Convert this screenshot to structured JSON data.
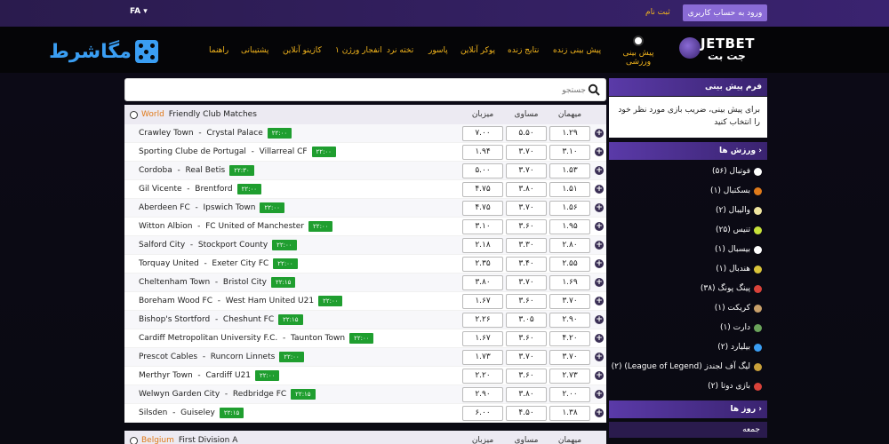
{
  "topbar": {
    "lang": "FA ▾",
    "register": "ثبت نام",
    "login": "ورود به حساب کاربری"
  },
  "logos": {
    "left": "مگاشرط",
    "right_latin": "JETBET",
    "right_fa": "جت بت"
  },
  "nav": {
    "sport_label": "پیش بینی ورزشی",
    "items": [
      "پیش بینی زنده",
      "نتایج زنده",
      "پوکر آنلاین",
      "پاسور",
      "تخته نرد",
      "انفجار ورژن ۱",
      "کازینو آنلاین",
      "پشتیبانی",
      "راهنما"
    ]
  },
  "sidebar": {
    "form_title": "فرم پیش بینی",
    "form_text": "برای پیش بینی، ضریب بازی مورد نظر خود را انتخاب کنید",
    "sports_title": "ورزش ها",
    "sports": [
      {
        "label": "فوتبال (۵۶)",
        "color": "#ffffff"
      },
      {
        "label": "بسکتبال (۱)",
        "color": "#e07a1a"
      },
      {
        "label": "والیبال (۲)",
        "color": "#f0e6a0"
      },
      {
        "label": "تنیس (۲۵)",
        "color": "#c8e23a"
      },
      {
        "label": "بیسبال (۱)",
        "color": "#ffffff"
      },
      {
        "label": "هندبال (۱)",
        "color": "#d9c43a"
      },
      {
        "label": "پینگ پونگ (۳۸)",
        "color": "#d9423a"
      },
      {
        "label": "کریکت (۱)",
        "color": "#c9a06a"
      },
      {
        "label": "دارت (۱)",
        "color": "#6aa35a"
      },
      {
        "label": "بیلیارد (۲)",
        "color": "#3a9ef3"
      },
      {
        "label": "لیگ آف لجندز (League of Legend) (۲)",
        "color": "#c9a03a"
      },
      {
        "label": "بازی دوتا (۲)",
        "color": "#d9423a"
      }
    ],
    "days_title": "روز ها",
    "day": "جمعه"
  },
  "search": {
    "placeholder": "جستجو"
  },
  "columns": {
    "home": "میزبان",
    "draw": "مساوی",
    "away": "میهمان"
  },
  "leagues": [
    {
      "country": "World",
      "name": "Friendly Club Matches",
      "matches": [
        {
          "home": "Crawley Town",
          "away": "Crystal Palace",
          "time": "۲۲:۰۰",
          "h": "۷.۰۰",
          "d": "۵.۵۰",
          "a": "۱.۲۹"
        },
        {
          "home": "Sporting Clube de Portugal",
          "away": "Villarreal CF",
          "time": "۲۲:۰۰",
          "h": "۱.۹۴",
          "d": "۳.۷۰",
          "a": "۳.۱۰"
        },
        {
          "home": "Cordoba",
          "away": "Real Betis",
          "time": "۲۲:۳۰",
          "h": "۵.۰۰",
          "d": "۳.۷۰",
          "a": "۱.۵۳"
        },
        {
          "home": "Gil Vicente",
          "away": "Brentford",
          "time": "۲۲:۰۰",
          "h": "۴.۷۵",
          "d": "۳.۸۰",
          "a": "۱.۵۱"
        },
        {
          "home": "Aberdeen FC",
          "away": "Ipswich Town",
          "time": "۲۲:۰۰",
          "h": "۴.۷۵",
          "d": "۳.۷۰",
          "a": "۱.۵۶"
        },
        {
          "home": "Witton Albion",
          "away": "FC United of Manchester",
          "time": "۲۲:۰۰",
          "h": "۳.۱۰",
          "d": "۳.۶۰",
          "a": "۱.۹۵"
        },
        {
          "home": "Salford City",
          "away": "Stockport County",
          "time": "۲۲:۰۰",
          "h": "۲.۱۸",
          "d": "۳.۳۰",
          "a": "۲.۸۰"
        },
        {
          "home": "Torquay United",
          "away": "Exeter City FC",
          "time": "۲۲:۰۰",
          "h": "۲.۳۵",
          "d": "۳.۴۰",
          "a": "۲.۵۵"
        },
        {
          "home": "Cheltenham Town",
          "away": "Bristol City",
          "time": "۲۲:۱۵",
          "h": "۳.۸۰",
          "d": "۳.۷۰",
          "a": "۱.۶۹"
        },
        {
          "home": "Boreham Wood FC",
          "away": "West Ham United U21",
          "time": "۲۲:۰۰",
          "h": "۱.۶۷",
          "d": "۳.۶۰",
          "a": "۳.۷۰"
        },
        {
          "home": "Bishop's Stortford",
          "away": "Cheshunt FC",
          "time": "۲۲:۱۵",
          "h": "۲.۲۶",
          "d": "۳.۰۵",
          "a": "۲.۹۰"
        },
        {
          "home": "Cardiff Metropolitan University F.C.",
          "away": "Taunton Town",
          "time": "۲۲:۰۰",
          "h": "۱.۶۷",
          "d": "۳.۶۰",
          "a": "۴.۲۰"
        },
        {
          "home": "Prescot Cables",
          "away": "Runcorn Linnets",
          "time": "۲۲:۰۰",
          "h": "۱.۷۳",
          "d": "۳.۷۰",
          "a": "۳.۷۰"
        },
        {
          "home": "Merthyr Town",
          "away": "Cardiff U21",
          "time": "۲۲:۰۰",
          "h": "۲.۲۰",
          "d": "۳.۶۰",
          "a": "۲.۷۳"
        },
        {
          "home": "Welwyn Garden City",
          "away": "Redbridge FC",
          "time": "۲۲:۱۵",
          "h": "۲.۹۰",
          "d": "۳.۸۰",
          "a": "۲.۰۰"
        },
        {
          "home": "Silsden",
          "away": "Guiseley",
          "time": "۲۲:۱۵",
          "h": "۶.۰۰",
          "d": "۴.۵۰",
          "a": "۱.۳۸"
        }
      ]
    },
    {
      "country": "Belgium",
      "name": "First Division A",
      "matches": []
    }
  ]
}
